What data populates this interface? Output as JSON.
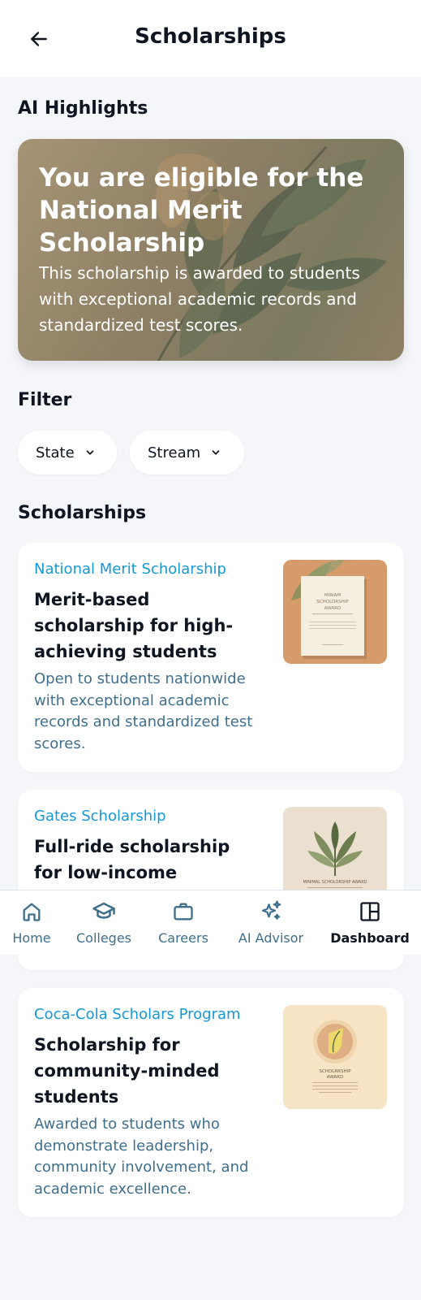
{
  "header": {
    "title": "Scholarships",
    "back_icon": "arrow-left-icon"
  },
  "highlights": {
    "section_title": "AI Highlights",
    "title": "You are eligible for the National Merit Scholarship",
    "text": "This scholarship is awarded to students with exceptional academic records and standardized test scores."
  },
  "filter": {
    "section_title": "Filter",
    "chips": [
      {
        "label": "State",
        "icon": "chevron-down-icon"
      },
      {
        "label": "Stream",
        "icon": "chevron-down-icon"
      }
    ]
  },
  "scholarships": {
    "section_title": "Scholarships",
    "items": [
      {
        "name": "National Merit Scholarship",
        "title": "Merit-based scholarship for high-achieving students",
        "description": "Open to students nationwide with exceptional academic records and standardized test scores.",
        "thumb_text": [
          "MIRIAM",
          "SCHOLORSHIP",
          "AWARD"
        ]
      },
      {
        "name": "Gates Scholarship",
        "title": "Full-ride scholarship for low-income students",
        "thumb_text": [
          "MINIMAL SCHOLORSHIP AWARD"
        ]
      },
      {
        "name": "Coca-Cola Scholars Program",
        "title": "Scholarship for community-minded students",
        "description": "Awarded to students who demonstrate leadership, community involvement, and academic excellence.",
        "thumb_text": [
          "SCHOLRRSHIP",
          "AWARD"
        ]
      }
    ]
  },
  "nav": {
    "items": [
      {
        "label": "Home",
        "icon": "home-icon",
        "active": false
      },
      {
        "label": "Colleges",
        "icon": "graduation-cap-icon",
        "active": false
      },
      {
        "label": "Careers",
        "icon": "briefcase-icon",
        "active": false
      },
      {
        "label": "AI Advisor",
        "icon": "sparkles-icon",
        "active": false
      },
      {
        "label": "Dashboard",
        "icon": "dashboard-icon",
        "active": true
      }
    ]
  },
  "colors": {
    "accent": "#1598d8",
    "muted_text": "#3f6f8c",
    "page_background": "#f4f6fa",
    "hero_background": "#8d7f64"
  }
}
